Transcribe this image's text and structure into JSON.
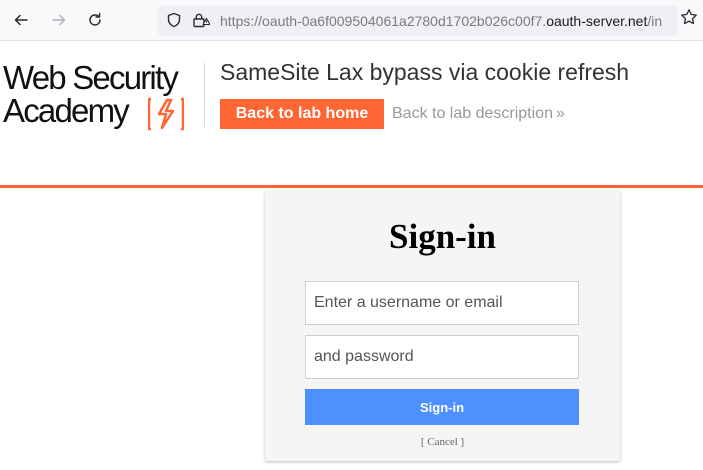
{
  "browser": {
    "url_prefix": "https://oauth-0a6f009504061a2780d1702b026c00f7.",
    "url_domain": "oauth-server.net",
    "url_tail": "/in",
    "icons": [
      "back-arrow-icon",
      "forward-arrow-icon",
      "reload-icon",
      "shield-icon",
      "lock-icon",
      "star-icon"
    ]
  },
  "header": {
    "logo_line1": "Web Security",
    "logo_line2": "Academy",
    "lab_title": "SameSite Lax bypass via cookie refresh",
    "back_home_label": "Back to lab home",
    "back_description_label": "Back to lab description",
    "description_chevron": "»",
    "accent_color": "#ff6633"
  },
  "signin": {
    "heading": "Sign-in",
    "username_placeholder": "Enter a username or email",
    "password_placeholder": "and password",
    "submit_label": "Sign-in",
    "cancel_label": "[ Cancel ]",
    "button_color": "#4d90fe"
  }
}
